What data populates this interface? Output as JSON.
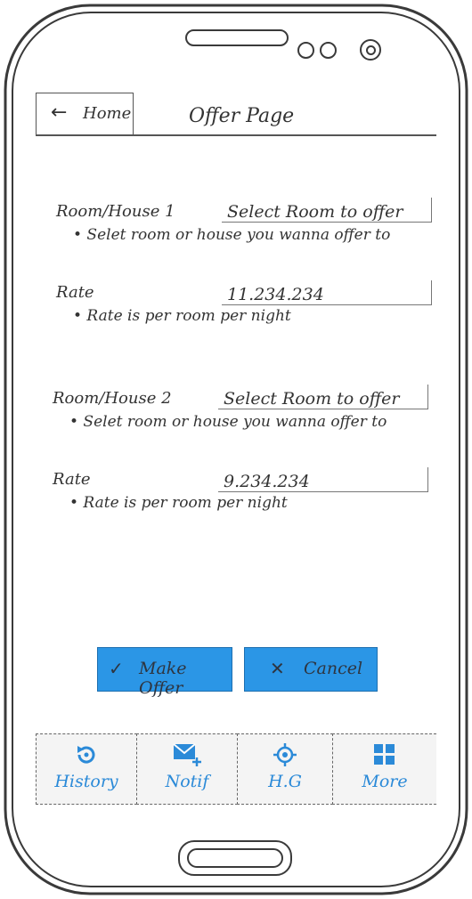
{
  "header": {
    "back_label": "Home",
    "back_icon": "arrow-left-icon",
    "title": "Offer Page"
  },
  "form": {
    "room1": {
      "label": "Room/House 1",
      "select_value": "Select Room to offer",
      "hint": "• Selet room or house you wanna offer to"
    },
    "rate1": {
      "label": "Rate",
      "value": "11.234.234",
      "hint": "• Rate is per room per night"
    },
    "room2": {
      "label": "Room/House 2",
      "select_value": "Select Room to offer",
      "hint": "• Selet room or house you wanna offer to"
    },
    "rate2": {
      "label": "Rate",
      "value": "9.234.234",
      "hint": "• Rate is per room per night"
    }
  },
  "actions": {
    "make_offer_label": "Make Offer",
    "make_offer_icon": "check-icon",
    "cancel_label": "Cancel",
    "cancel_icon": "x-icon"
  },
  "tabbar": {
    "items": [
      {
        "label": "History",
        "icon": "history-icon"
      },
      {
        "label": "Notif",
        "icon": "mail-add-icon"
      },
      {
        "label": "H.G",
        "icon": "crosshair-icon"
      },
      {
        "label": "More",
        "icon": "grid-icon"
      }
    ]
  },
  "colors": {
    "accent": "#2b96e6",
    "tab_label": "#2b8ad8"
  }
}
